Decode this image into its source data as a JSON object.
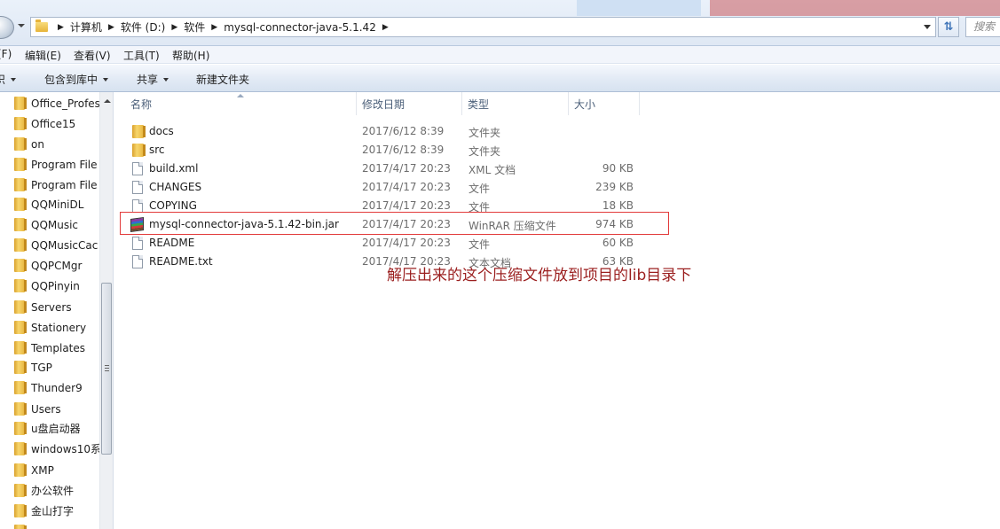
{
  "address_bar": {
    "breadcrumbs": [
      "计算机",
      "软件 (D:)",
      "软件",
      "mysql-connector-java-5.1.42"
    ],
    "search_placeholder": "搜索"
  },
  "menu": {
    "items": [
      "(F)",
      "编辑(E)",
      "查看(V)",
      "工具(T)",
      "帮助(H)"
    ]
  },
  "toolbar": {
    "left_fragment": "织",
    "include_in_library": "包含到库中",
    "share": "共享",
    "new_folder": "新建文件夹"
  },
  "nav_pane": {
    "items": [
      "Office_Profes",
      "Office15",
      "on",
      "Program File",
      "Program File",
      "QQMiniDL",
      "QQMusic",
      "QQMusicCac",
      "QQPCMgr",
      "QQPinyin",
      "Servers",
      "Stationery",
      "Templates",
      "TGP",
      "Thunder9",
      "Users",
      "u盘启动器",
      "windows10系",
      "XMP",
      "办公软件",
      "金山打字"
    ]
  },
  "file_list": {
    "columns": [
      "名称",
      "修改日期",
      "类型",
      "大小"
    ],
    "rows": [
      {
        "icon": "folder-icon",
        "name": "docs",
        "date": "2017/6/12 8:39",
        "type": "文件夹",
        "size": ""
      },
      {
        "icon": "folder-icon",
        "name": "src",
        "date": "2017/6/12 8:39",
        "type": "文件夹",
        "size": ""
      },
      {
        "icon": "file-icon",
        "name": "build.xml",
        "date": "2017/4/17 20:23",
        "type": "XML 文档",
        "size": "90 KB"
      },
      {
        "icon": "file-icon",
        "name": "CHANGES",
        "date": "2017/4/17 20:23",
        "type": "文件",
        "size": "239 KB"
      },
      {
        "icon": "file-icon",
        "name": "COPYING",
        "date": "2017/4/17 20:23",
        "type": "文件",
        "size": "18 KB"
      },
      {
        "icon": "winrar-archive-icon",
        "name": "mysql-connector-java-5.1.42-bin.jar",
        "date": "2017/4/17 20:23",
        "type": "WinRAR 压缩文件",
        "size": "974 KB"
      },
      {
        "icon": "file-icon",
        "name": "README",
        "date": "2017/4/17 20:23",
        "type": "文件",
        "size": "60 KB"
      },
      {
        "icon": "file-icon",
        "name": "README.txt",
        "date": "2017/4/17 20:23",
        "type": "文本文档",
        "size": "63 KB"
      }
    ]
  },
  "annotation": {
    "text": "解压出来的这个压缩文件放到项目的lib目录下",
    "color": "#9b1f1f",
    "highlight_color": "#e23a3a"
  }
}
